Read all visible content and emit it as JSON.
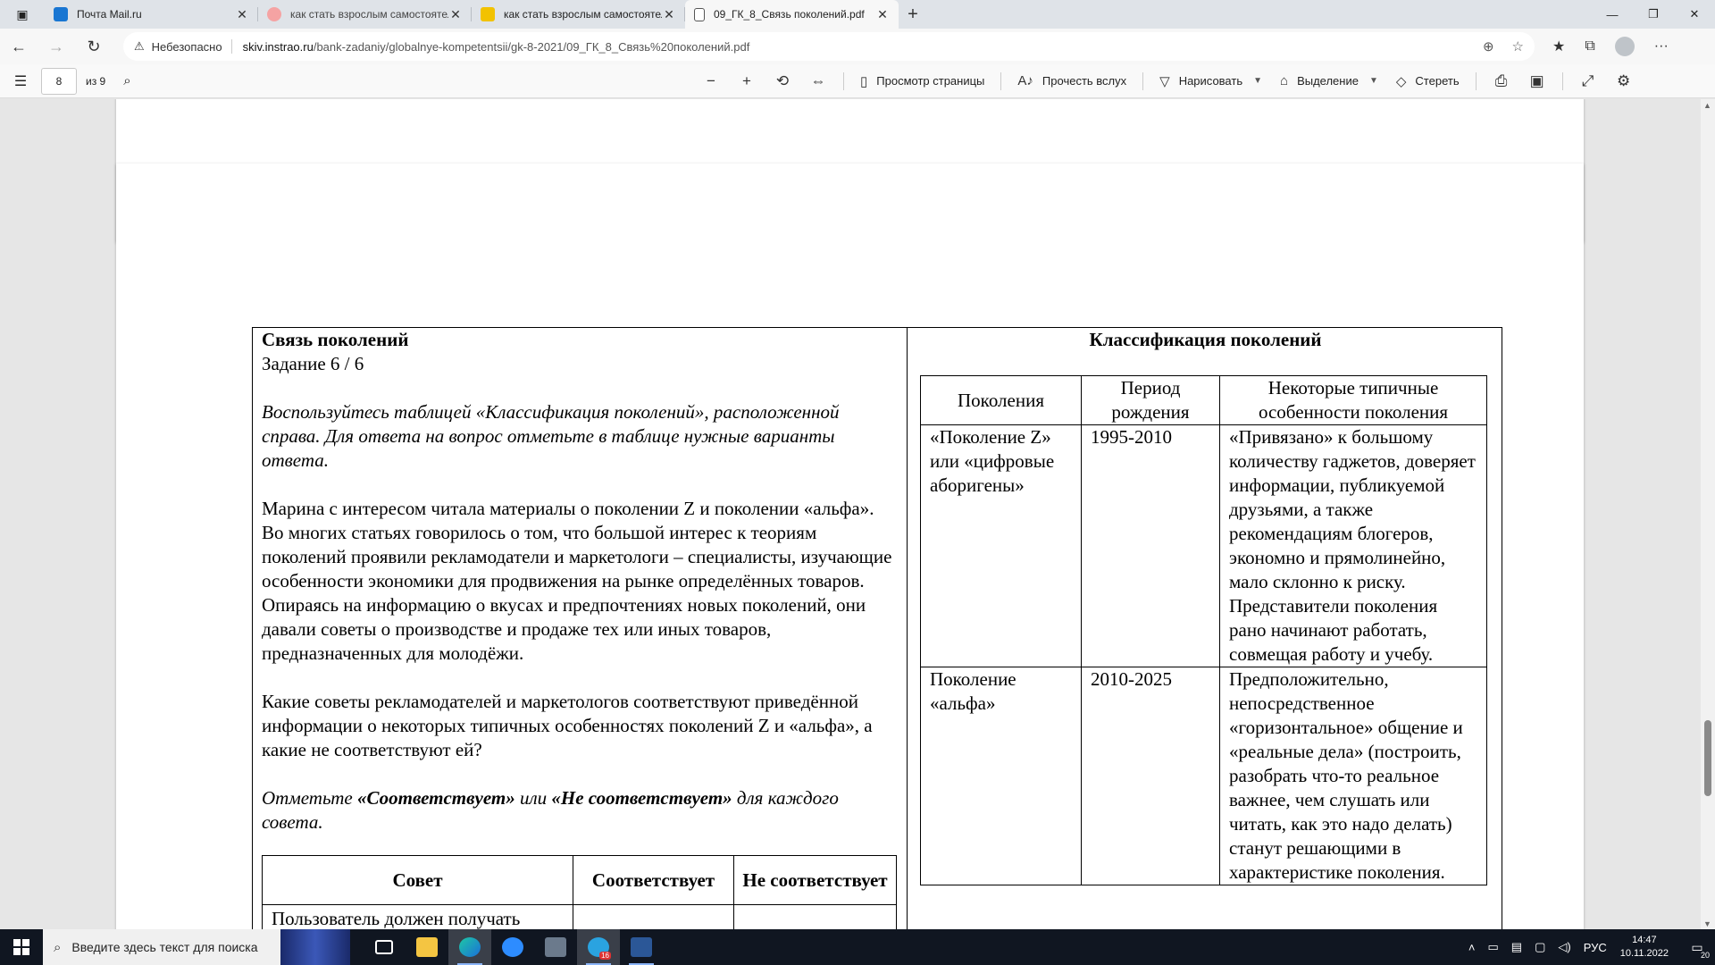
{
  "browser": {
    "tabs": [
      {
        "title": "Почта Mail.ru",
        "icon_color": "#1976d2",
        "active": false
      },
      {
        "title": "как стать взрослым самостоятельным",
        "icon_color": "#f5a3a3",
        "active": false
      },
      {
        "title": "как стать взрослым самостоятельным",
        "icon_color": "#f2c200",
        "active": false
      },
      {
        "title": "09_ГК_8_Связь поколений.pdf",
        "icon_color": "#ffffff",
        "active": true
      }
    ],
    "new_tab": "+",
    "address": {
      "security_label": "Небезопасно",
      "host": "skiv.instrao.ru",
      "path": "/bank-zadaniy/globalnye-kompetentsii/gk-8-2021/09_ГК_8_Связь%20поколений.pdf"
    }
  },
  "pdf_toolbar": {
    "page_number": "8",
    "page_total": "из 9",
    "view_page": "Просмотр страницы",
    "read_aloud": "Прочесть вслух",
    "draw": "Нарисовать",
    "highlight": "Выделение",
    "erase": "Стереть"
  },
  "document": {
    "left": {
      "title": "Связь поколений",
      "task": "Задание 6 / 6",
      "instruction": "Воспользуйтесь таблицей «Классификация поколений», расположенной справа. Для ответа на вопрос отметьте в таблице нужные варианты ответа.",
      "paragraph": "Марина с интересом читала материалы о поколении Z и поколении «альфа». Во многих статьях говорилось о том, что большой интерес к теориям поколений проявили рекламодатели и маркетологи – специалисты, изучающие особенности экономики для продвижения на рынке определённых товаров. Опираясь на информацию о вкусах и предпочтениях новых поколений, они давали советы о производстве и продаже тех или иных товаров, предназначенных для молодёжи.",
      "question": "Какие советы рекламодателей и маркетологов соответствуют приведённой информации о некоторых типичных особенностях поколений Z и «альфа», а какие не соответствуют ей?",
      "mark_prefix": "Отметьте ",
      "mark_yes": "«Соответствует»",
      "mark_or": " или ",
      "mark_no": "«Не соответствует»",
      "mark_suffix": " для каждого совета.",
      "advice_table": {
        "headers": [
          "Совет",
          "Соответствует",
          "Не соответствует"
        ],
        "rows": [
          {
            "advice": "Пользователь должен получать короткую инструкцию, представленную текстом, и видеоматериал, в котором"
          }
        ]
      }
    },
    "right": {
      "title": "Классификация поколений",
      "table": {
        "headers": [
          "Поколения",
          "Период рождения",
          "Некоторые типичные особенности поколения"
        ],
        "rows": [
          {
            "generation": "«Поколение Z» или «цифровые аборигены»",
            "period": "1995-2010",
            "features": "«Привязано» к большому количеству гаджетов, доверяет информации, публикуемой друзьями, а также рекомендациям блогеров, экономно и прямолинейно, мало склонно к риску. Представители поколения рано начинают работать, совмещая работу и учебу."
          },
          {
            "generation": "Поколение «альфа»",
            "period": "2010-2025",
            "features": "Предположительно, непосредственное «горизонтальное» общение и «реальные дела» (построить, разобрать что-то реальное важнее, чем слушать или читать, как это надо делать) станут решающими в характеристике поколения."
          }
        ]
      }
    }
  },
  "taskbar": {
    "search_placeholder": "Введите здесь текст для поиска",
    "language": "РУС",
    "time": "14:47",
    "date": "10.11.2022",
    "notification_count": "20",
    "telegram_badge": "16"
  }
}
